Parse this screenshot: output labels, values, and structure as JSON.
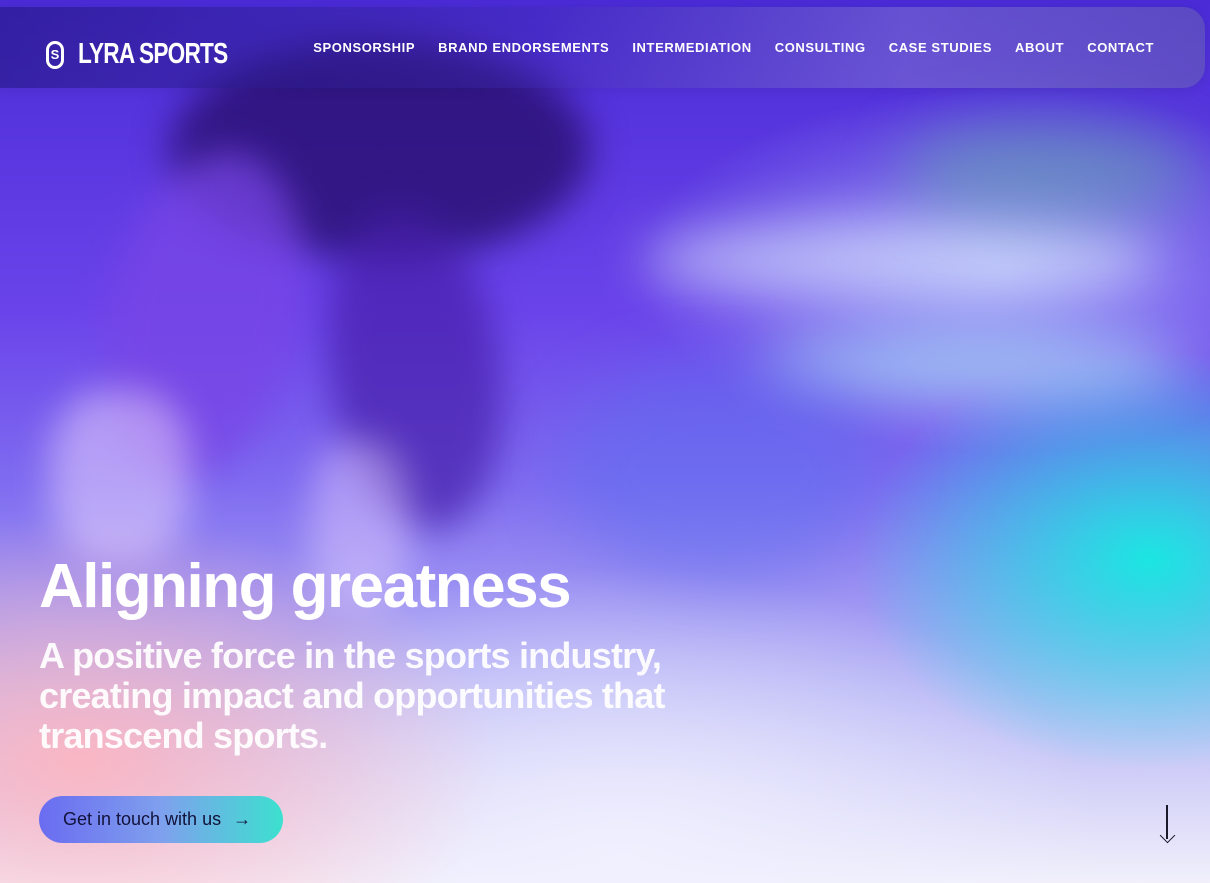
{
  "brand": {
    "logo_mark": "S",
    "name": "LYRA SPORTS"
  },
  "nav": {
    "items": [
      {
        "label": "SPONSORSHIP"
      },
      {
        "label": "BRAND ENDORSEMENTS"
      },
      {
        "label": "INTERMEDIATION"
      },
      {
        "label": "CONSULTING"
      },
      {
        "label": "CASE STUDIES"
      },
      {
        "label": "ABOUT"
      },
      {
        "label": "CONTACT"
      }
    ]
  },
  "hero": {
    "headline": "Aligning greatness",
    "subheadline": "A positive force in the sports industry, creating impact and opportunities that transcend sports.",
    "cta_label": "Get in touch with us",
    "cta_icon": "arrow-right-icon",
    "scroll_icon": "arrow-down-icon"
  },
  "colors": {
    "accent_start": "#6a6cf0",
    "accent_end": "#3ce0cf",
    "background_primary": "#5a3fe0",
    "text_light": "#ffffff"
  }
}
